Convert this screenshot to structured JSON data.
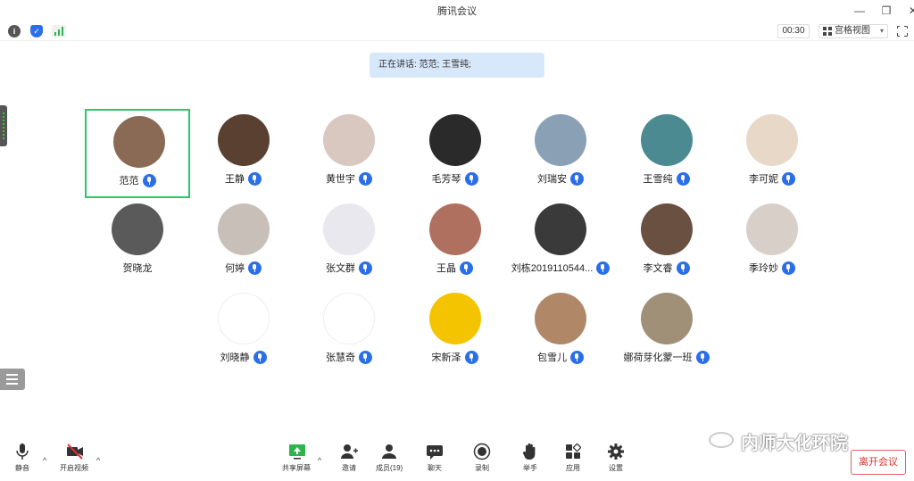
{
  "window": {
    "title": "腾讯会议",
    "minimize": "—",
    "restore": "❐",
    "close": "✕"
  },
  "toolbar": {
    "timer": "00:30",
    "view_label": "宫格视图"
  },
  "speaking": {
    "text": "正在讲话: 范范; 王雪纯;"
  },
  "participants": [
    {
      "name": "范范",
      "mic": true,
      "active": true,
      "avatar_color": "#8a6a55"
    },
    {
      "name": "王静",
      "mic": true,
      "avatar_color": "#5a4030"
    },
    {
      "name": "黄世宇",
      "mic": true,
      "avatar_color": "#d8c8c0"
    },
    {
      "name": "毛芳琴",
      "mic": true,
      "avatar_color": "#2a2a2a"
    },
    {
      "name": "刘瑞安",
      "mic": true,
      "avatar_color": "#8aa0b5"
    },
    {
      "name": "王雪纯",
      "mic": true,
      "avatar_color": "#4a8a90"
    },
    {
      "name": "李可妮",
      "mic": true,
      "avatar_color": "#e8d8c8"
    },
    {
      "name": "贺晓龙",
      "mic": false,
      "avatar_color": "#5a5a5a"
    },
    {
      "name": "何婷",
      "mic": true,
      "avatar_color": "#c8c0b8"
    },
    {
      "name": "张文群",
      "mic": true,
      "avatar_color": "#e8e8ee"
    },
    {
      "name": "王晶",
      "mic": true,
      "avatar_color": "#b07060"
    },
    {
      "name": "刘栋2019110544",
      "display": "刘栋2019110544...",
      "mic": true,
      "avatar_color": "#3a3a3a"
    },
    {
      "name": "李文睿",
      "mic": true,
      "avatar_color": "#6a5040"
    },
    {
      "name": "季玲妙",
      "mic": true,
      "avatar_color": "#d8d0c8"
    },
    {
      "name": "刘晓静",
      "mic": true,
      "avatar_color": "#ffffff"
    },
    {
      "name": "张慧奇",
      "mic": true,
      "avatar_color": "#ffffff"
    },
    {
      "name": "宋新泽",
      "mic": true,
      "avatar_color": "#f5c400"
    },
    {
      "name": "包雪儿",
      "mic": true,
      "avatar_color": "#b08868"
    },
    {
      "name": "娜荷芽化蒙一班",
      "mic": true,
      "avatar_color": "#a09078"
    }
  ],
  "bottom": {
    "mute": "静音",
    "video": "开启视频",
    "share": "共享屏幕",
    "invite": "邀请",
    "members": "成员(19)",
    "chat": "聊天",
    "record": "录制",
    "raise_hand": "举手",
    "apps": "应用",
    "settings": "设置",
    "leave": "离开会议"
  },
  "watermark": "内师大化环院"
}
